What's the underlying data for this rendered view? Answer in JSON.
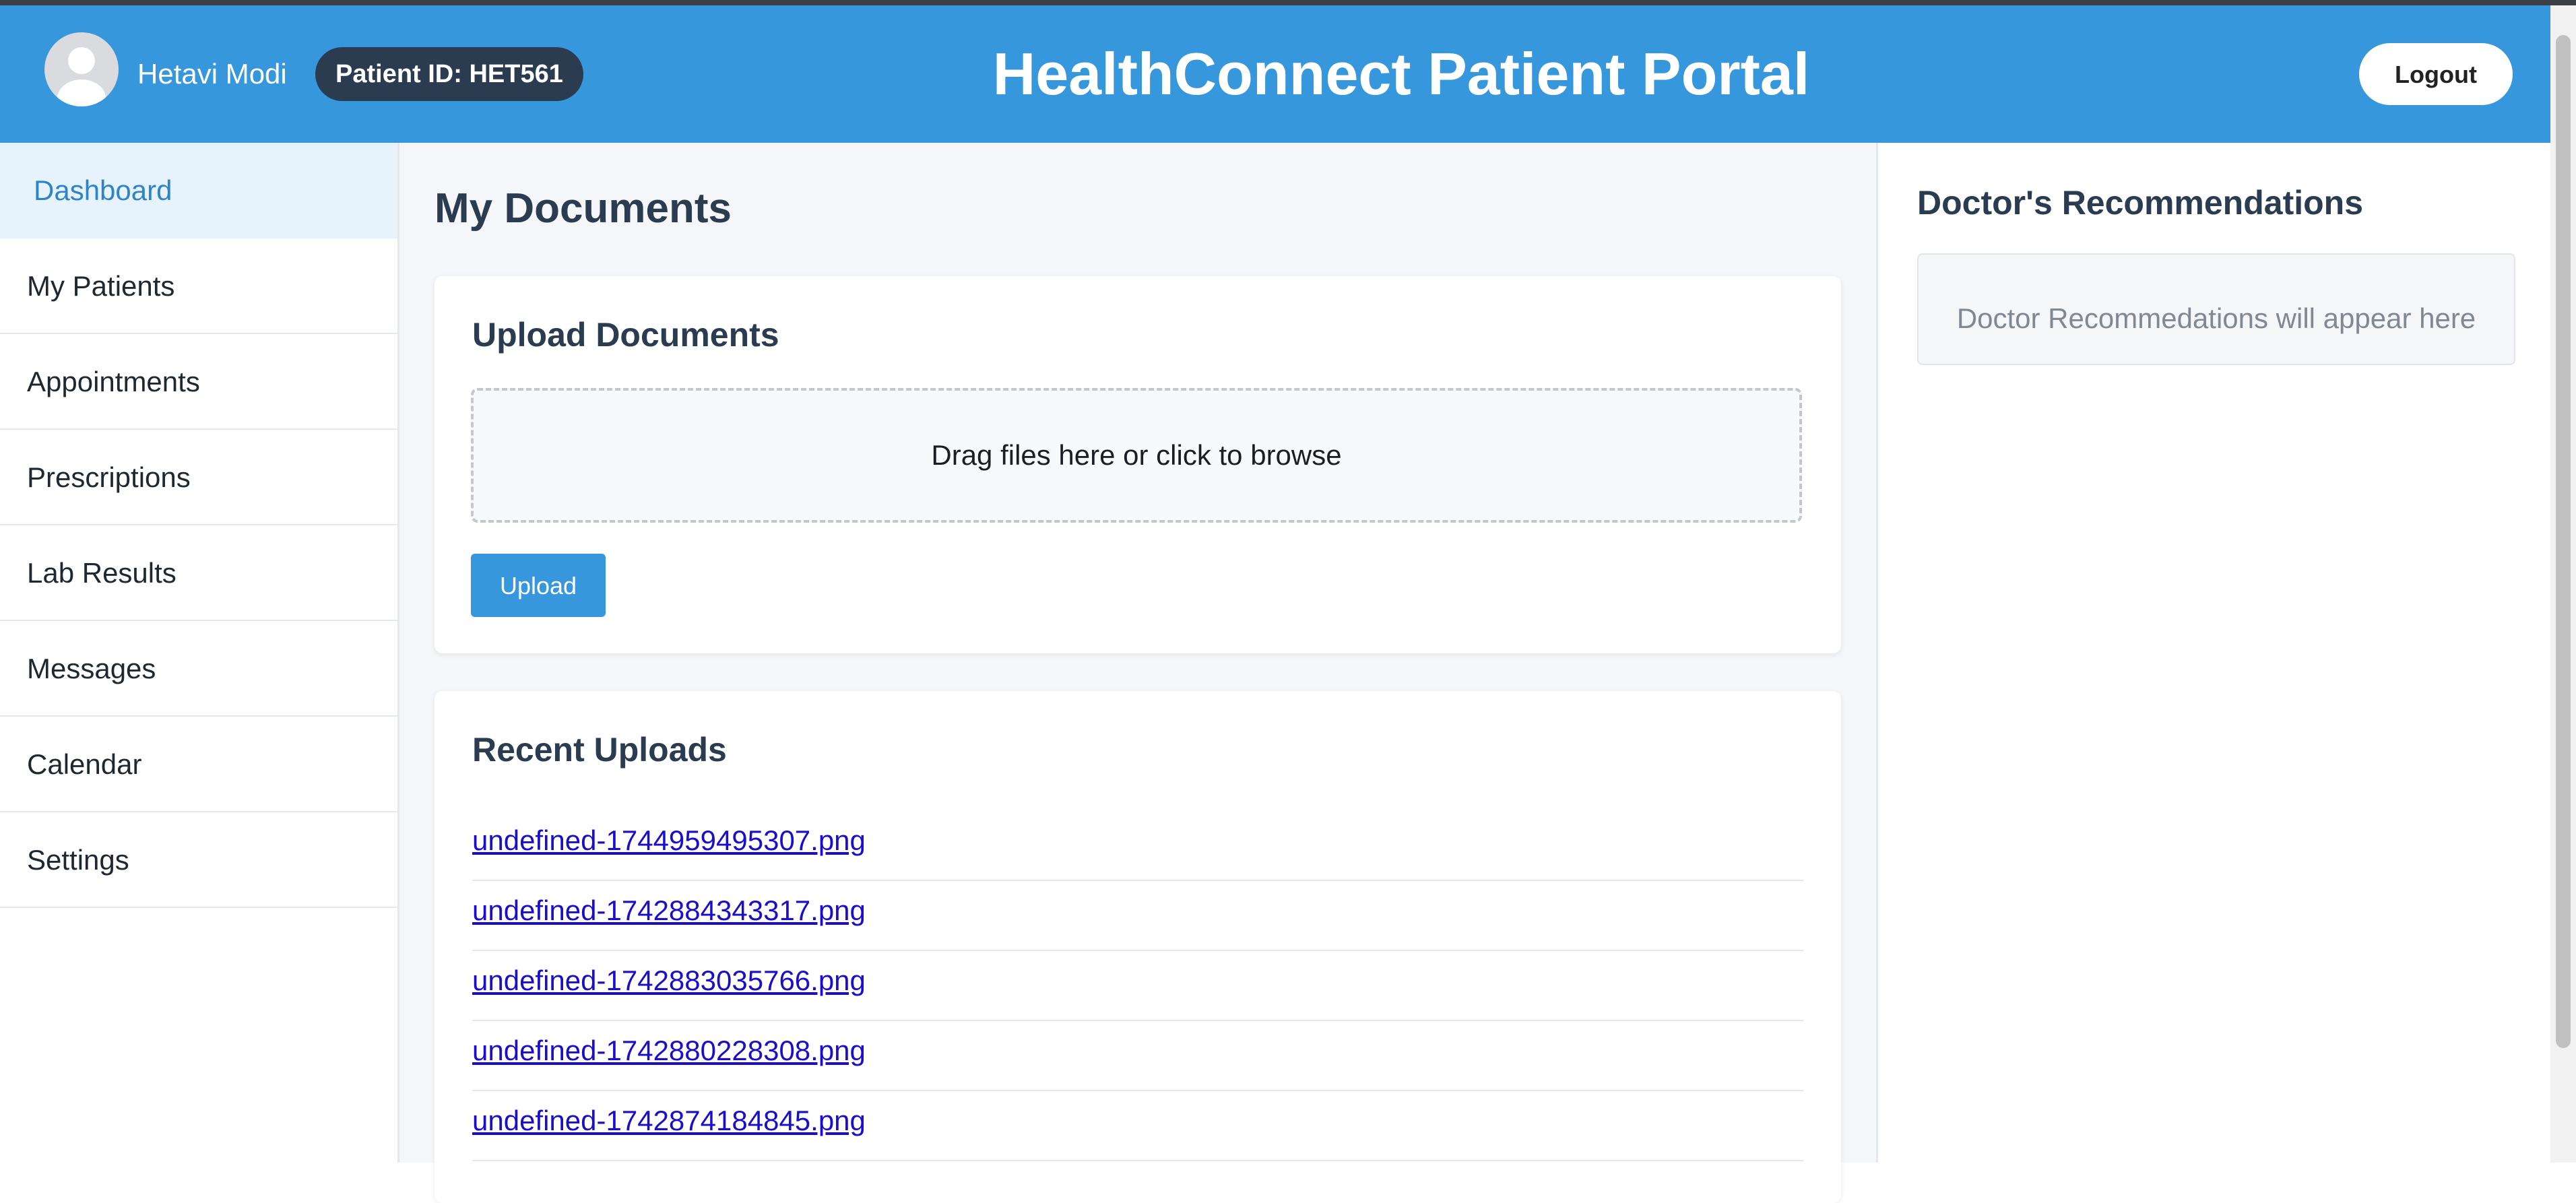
{
  "header": {
    "user_name": "Hetavi Modi",
    "patient_id": "Patient ID: HET561",
    "title": "HealthConnect Patient Portal",
    "logout_label": "Logout",
    "avatar_icon": "user-avatar-icon"
  },
  "sidebar": {
    "items": [
      {
        "label": "Dashboard",
        "active": true
      },
      {
        "label": "My Patients"
      },
      {
        "label": "Appointments"
      },
      {
        "label": "Prescriptions"
      },
      {
        "label": "Lab Results"
      },
      {
        "label": "Messages"
      },
      {
        "label": "Calendar"
      },
      {
        "label": "Settings"
      }
    ]
  },
  "main": {
    "page_title": "My Documents",
    "upload": {
      "title": "Upload Documents",
      "dropzone_text": "Drag files here or click to browse",
      "button_label": "Upload"
    },
    "recent": {
      "title": "Recent Uploads",
      "files": [
        "undefined-1744959495307.png",
        "undefined-1742884343317.png",
        "undefined-1742883035766.png",
        "undefined-1742880228308.png",
        "undefined-1742874184845.png"
      ]
    }
  },
  "right_panel": {
    "title": "Doctor's Recommendations",
    "placeholder": "Doctor Recommedations will appear here"
  },
  "colors": {
    "header_bg": "#3797dc",
    "badge_bg": "#2b3c50",
    "accent": "#3797dc",
    "active_nav_bg": "#e6f2fc",
    "link": "#1a0dcc"
  }
}
